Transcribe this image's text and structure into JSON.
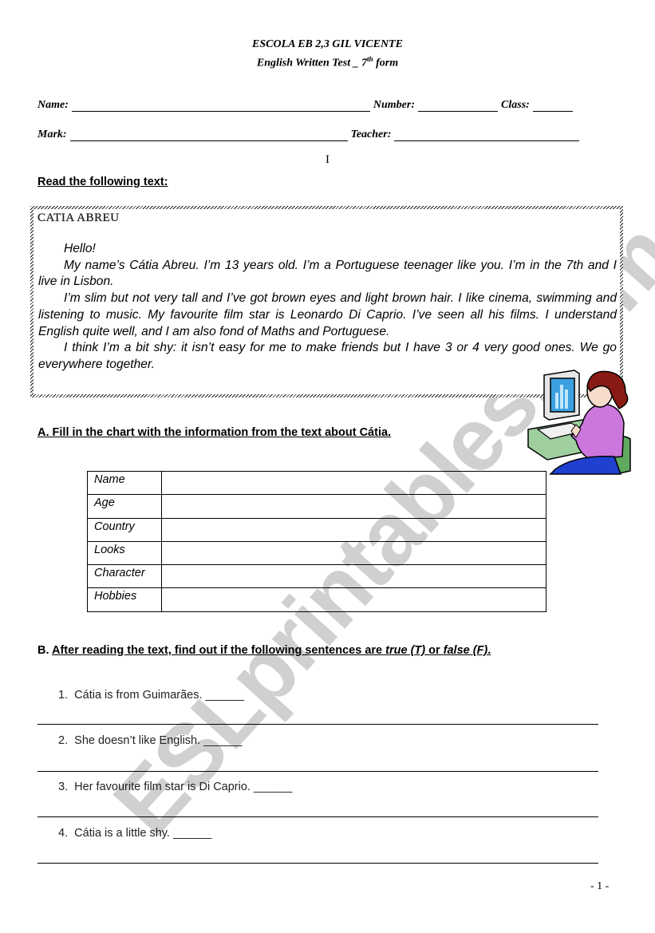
{
  "header": {
    "school": "ESCOLA EB 2,3 GIL VICENTE",
    "test_title_pre": "English Written Test _ 7",
    "test_title_sup": "th",
    "test_title_post": " form"
  },
  "student_fields": {
    "name_label": "Name:",
    "number_label": "Number:",
    "class_label": "Class:",
    "mark_label": "Mark:",
    "teacher_label": "Teacher:"
  },
  "part_number": "I",
  "reading_instruction": "Read the following text:",
  "text_box": {
    "title": "CATIA ABREU",
    "paragraphs": [
      "Hello!",
      "My name’s Cátia Abreu. I’m 13 years old. I’m a Portuguese teenager like you. I’m in the 7th  and I live in Lisbon.",
      "I’m slim but not very tall and I’ve got brown eyes and light brown hair. I like cinema, swimming and listening to music. My favourite film star is Leonardo Di Caprio. I’ve seen all his films. I understand English quite well, and I am also fond of Maths and Portuguese.",
      "I think I’m a bit shy: it isn’t easy for me to make friends but I have 3 or 4 very good ones. We go everywhere together."
    ]
  },
  "clipart": {
    "icon": "girl-at-computer-clipart"
  },
  "section_a": {
    "instruction": "A. Fill in the chart with the information from the text about Cátia.",
    "rows": [
      {
        "label": "Name",
        "value": ""
      },
      {
        "label": "Age",
        "value": ""
      },
      {
        "label": "Country",
        "value": ""
      },
      {
        "label": "Looks",
        "value": ""
      },
      {
        "label": "Character",
        "value": ""
      },
      {
        "label": "Hobbies",
        "value": ""
      }
    ]
  },
  "section_b": {
    "prefix": "B. ",
    "instruction_pre": "After reading the text, find out if the following sentences are ",
    "true_word": "true",
    "true_abbr": " (T)",
    "or_word": " or ",
    "false_word": "false",
    "false_abbr": " (F)",
    "end": ".",
    "items": [
      {
        "num": "1.",
        "text": "Cátia is from Guimarães. ______"
      },
      {
        "num": "2.",
        "text": "She doesn’t like English. ______"
      },
      {
        "num": "3.",
        "text": "Her favourite film star is Di Caprio. ______"
      },
      {
        "num": "4.",
        "text": "Cátia is a little shy. ______"
      }
    ]
  },
  "page_number": "- 1 -",
  "watermark": "ESLprintables.com"
}
